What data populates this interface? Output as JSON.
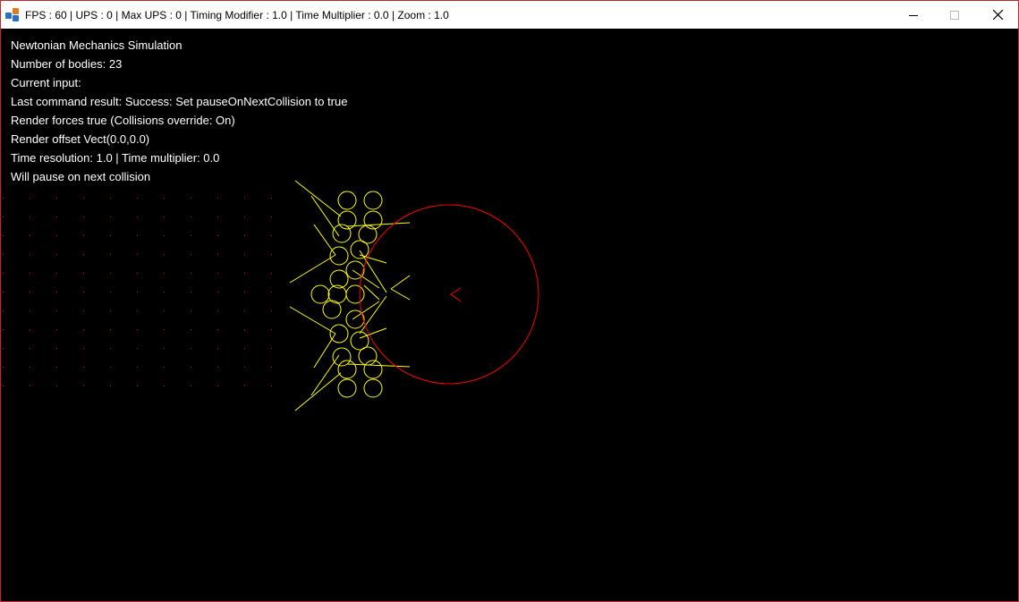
{
  "window": {
    "title": "FPS : 60 | UPS : 0 | Max UPS : 0 | Timing Modifier : 1.0 | Time Multiplier : 0.0 | Zoom : 1.0",
    "icon": "java-cup-icon",
    "controls": {
      "minimize": "minimize-icon",
      "maximize": "maximize-icon",
      "close": "close-icon"
    }
  },
  "info": {
    "heading": "Newtonian Mechanics Simulation",
    "bodies": "Number of bodies: 23",
    "current_input": "Current input:",
    "last_command": "Last command result: Success: Set pauseOnNextCollision to true",
    "render_forces": "Render forces true (Collisions override: On)",
    "render_offset": "Render offset Vect(0.0,0.0)",
    "time": "Time resolution: 1.0 | Time multiplier: 0.0",
    "pause_note": "Will pause on next collision"
  },
  "colors": {
    "background": "#000000",
    "text": "#ffffff",
    "body_outline": "#ffff00",
    "force_line": "#ffff00",
    "large_body": "#ff0000",
    "grid_dot": "#ff0000",
    "window_border": "#c4282c"
  }
}
